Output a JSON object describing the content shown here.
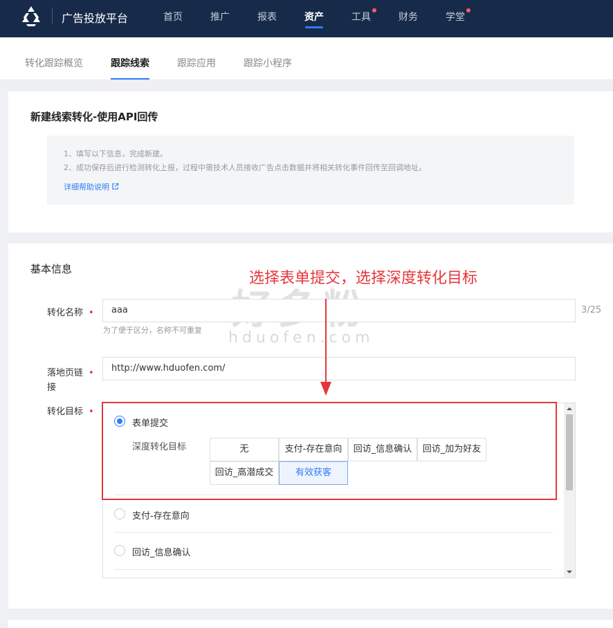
{
  "nav": {
    "app_title": "广告投放平台",
    "items": [
      "首页",
      "推广",
      "报表",
      "资产",
      "工具",
      "财务",
      "学堂"
    ],
    "active": "资产"
  },
  "subtabs": {
    "items": [
      "转化跟踪概览",
      "跟踪线索",
      "跟踪应用",
      "跟踪小程序"
    ],
    "active": "跟踪线索"
  },
  "intro_card": {
    "title": "新建线索转化-使用API回传",
    "notes": [
      "1、填写以下信息，完成新建。",
      "2、成功保存后进行检测转化上报，过程中需技术人员接收广告点击数据并将相关转化事件回传至回调地址。"
    ],
    "help_link": "详细帮助说明"
  },
  "form": {
    "section_title": "基本信息",
    "name_label": "转化名称",
    "name_value": "aaa",
    "name_counter": "3/25",
    "name_hint": "为了便于区分，名称不可重复",
    "landing_label_line1": "落地页链",
    "landing_label_line2": "接",
    "landing_value": "http://www.hduofen.com/",
    "goal_label": "转化目标",
    "required_mark": "•",
    "goal_options": [
      {
        "label": "表单提交",
        "checked": true
      },
      {
        "label": "支付-存在意向",
        "checked": false
      },
      {
        "label": "回访_信息确认",
        "checked": false
      }
    ],
    "deep_goal_label": "深度转化目标",
    "deep_goal_options": [
      "无",
      "支付-存在意向",
      "回访_信息确认",
      "回访_加为好友",
      "回访_高潜成交",
      "有效获客"
    ],
    "deep_goal_selected": "有效获客"
  },
  "annotation": {
    "text": "选择表单提交，选择深度转化目标",
    "color": "#e5373b"
  },
  "watermark": {
    "main": "好多粉",
    "sub": "hduofen.com"
  },
  "colors": {
    "nav_bg": "#172a4a",
    "accent": "#2f7cf6",
    "alert": "#e5373b"
  }
}
